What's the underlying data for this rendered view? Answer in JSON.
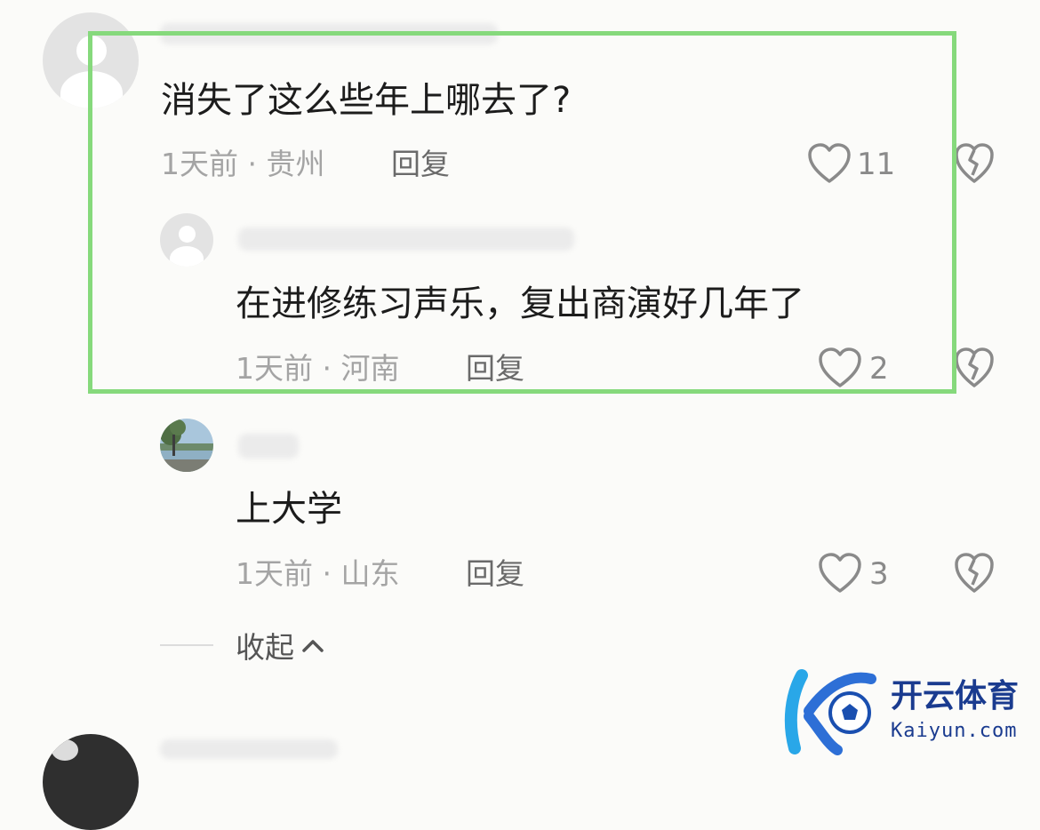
{
  "comments": [
    {
      "text": "消失了这么些年上哪去了?",
      "meta": "1天前 · 贵州",
      "reply_label": "回复",
      "likes": "11"
    },
    {
      "text": "在进修练习声乐，复出商演好几年了",
      "meta": "1天前 · 河南",
      "reply_label": "回复",
      "likes": "2"
    },
    {
      "text": "上大学",
      "meta": "1天前 · 山东",
      "reply_label": "回复",
      "likes": "3"
    }
  ],
  "collapse": {
    "label": "收起"
  },
  "watermark": {
    "brand": "开云体育",
    "domain": "Kaiyun.com"
  },
  "colors": {
    "highlight": "#86d97c",
    "watermark": "#1a3b8f"
  },
  "icons": [
    "heart-outline-icon",
    "broken-heart-icon",
    "chevron-up-icon",
    "default-avatar-icon"
  ]
}
